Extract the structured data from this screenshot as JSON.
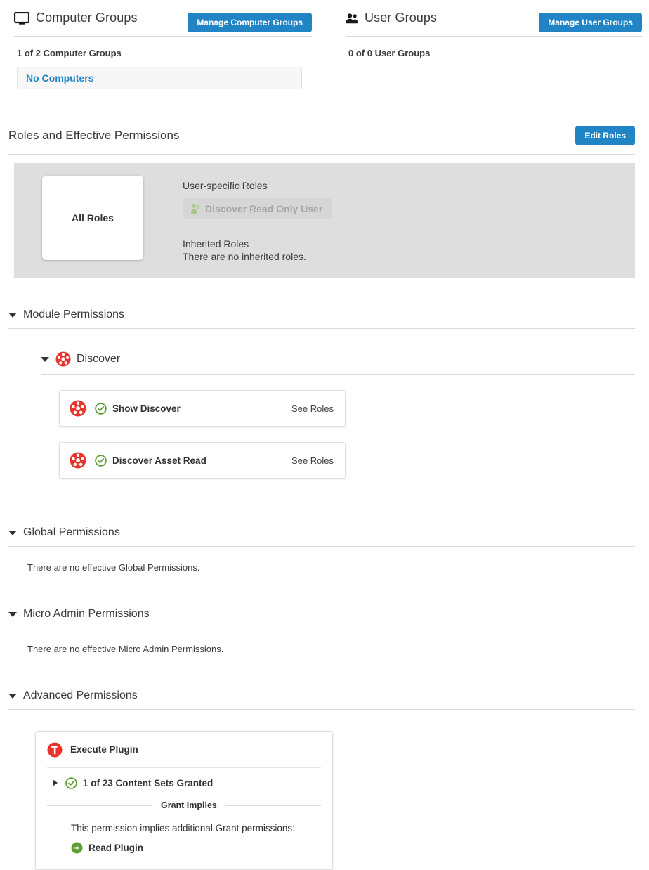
{
  "computer_groups": {
    "icon": "monitor-icon",
    "title": "Computer Groups",
    "manage_button": "Manage Computer Groups",
    "count": "1 of 2 Computer Groups",
    "item": "No Computers"
  },
  "user_groups": {
    "icon": "users-icon",
    "title": "User Groups",
    "manage_button": "Manage User Groups",
    "count": "0 of 0 User Groups"
  },
  "roles_section": {
    "title": "Roles and Effective Permissions",
    "edit_button": "Edit Roles",
    "all_roles_card": "All Roles",
    "user_specific_label": "User-specific Roles",
    "user_specific_roles": [
      {
        "label": "Discover Read Only User",
        "icon": "user-role-icon"
      }
    ],
    "inherited_label": "Inherited Roles",
    "inherited_empty": "There are no inherited roles."
  },
  "module_permissions": {
    "header": "Module Permissions",
    "modules": [
      {
        "name": "Discover",
        "icon": "discover-icon",
        "permissions": [
          {
            "label": "Show Discover",
            "action": "See Roles",
            "status": "granted"
          },
          {
            "label": "Discover Asset Read",
            "action": "See Roles",
            "status": "granted"
          }
        ]
      }
    ]
  },
  "global_permissions": {
    "header": "Global Permissions",
    "empty": "There are no effective Global Permissions."
  },
  "micro_admin_permissions": {
    "header": "Micro Admin Permissions",
    "empty": "There are no effective Micro Admin Permissions."
  },
  "advanced_permissions": {
    "header": "Advanced Permissions",
    "card": {
      "icon": "tanium-logo-icon",
      "title": "Execute Plugin",
      "content_sets": "1 of 23 Content Sets Granted",
      "grant_implies_label": "Grant Implies",
      "implies_note": "This permission implies additional Grant permissions:",
      "implied": [
        {
          "label": "Read Plugin",
          "icon": "arrow-right-circle-icon"
        }
      ]
    }
  },
  "colors": {
    "accent_blue": "#2185c5",
    "module_red": "#e8342a",
    "granted_green": "#5d9e32",
    "panel_gray": "#dedede"
  }
}
